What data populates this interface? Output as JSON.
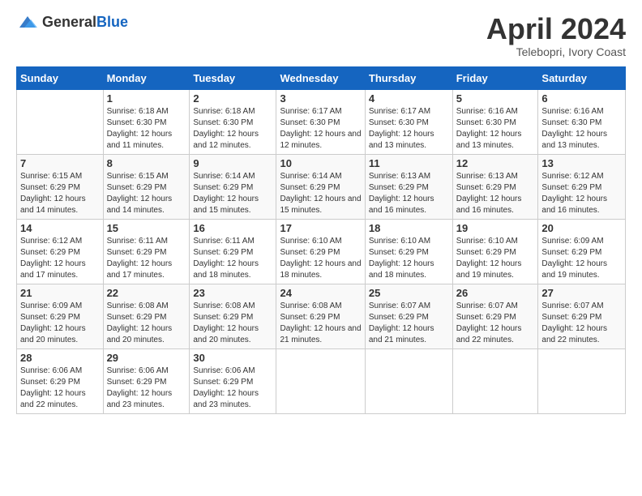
{
  "header": {
    "logo_general": "General",
    "logo_blue": "Blue",
    "title": "April 2024",
    "subtitle": "Telebopri, Ivory Coast"
  },
  "calendar": {
    "days_of_week": [
      "Sunday",
      "Monday",
      "Tuesday",
      "Wednesday",
      "Thursday",
      "Friday",
      "Saturday"
    ],
    "weeks": [
      [
        {
          "day": "",
          "sunrise": "",
          "sunset": "",
          "daylight": ""
        },
        {
          "day": "1",
          "sunrise": "Sunrise: 6:18 AM",
          "sunset": "Sunset: 6:30 PM",
          "daylight": "Daylight: 12 hours and 11 minutes."
        },
        {
          "day": "2",
          "sunrise": "Sunrise: 6:18 AM",
          "sunset": "Sunset: 6:30 PM",
          "daylight": "Daylight: 12 hours and 12 minutes."
        },
        {
          "day": "3",
          "sunrise": "Sunrise: 6:17 AM",
          "sunset": "Sunset: 6:30 PM",
          "daylight": "Daylight: 12 hours and 12 minutes."
        },
        {
          "day": "4",
          "sunrise": "Sunrise: 6:17 AM",
          "sunset": "Sunset: 6:30 PM",
          "daylight": "Daylight: 12 hours and 13 minutes."
        },
        {
          "day": "5",
          "sunrise": "Sunrise: 6:16 AM",
          "sunset": "Sunset: 6:30 PM",
          "daylight": "Daylight: 12 hours and 13 minutes."
        },
        {
          "day": "6",
          "sunrise": "Sunrise: 6:16 AM",
          "sunset": "Sunset: 6:30 PM",
          "daylight": "Daylight: 12 hours and 13 minutes."
        }
      ],
      [
        {
          "day": "7",
          "sunrise": "Sunrise: 6:15 AM",
          "sunset": "Sunset: 6:29 PM",
          "daylight": "Daylight: 12 hours and 14 minutes."
        },
        {
          "day": "8",
          "sunrise": "Sunrise: 6:15 AM",
          "sunset": "Sunset: 6:29 PM",
          "daylight": "Daylight: 12 hours and 14 minutes."
        },
        {
          "day": "9",
          "sunrise": "Sunrise: 6:14 AM",
          "sunset": "Sunset: 6:29 PM",
          "daylight": "Daylight: 12 hours and 15 minutes."
        },
        {
          "day": "10",
          "sunrise": "Sunrise: 6:14 AM",
          "sunset": "Sunset: 6:29 PM",
          "daylight": "Daylight: 12 hours and 15 minutes."
        },
        {
          "day": "11",
          "sunrise": "Sunrise: 6:13 AM",
          "sunset": "Sunset: 6:29 PM",
          "daylight": "Daylight: 12 hours and 16 minutes."
        },
        {
          "day": "12",
          "sunrise": "Sunrise: 6:13 AM",
          "sunset": "Sunset: 6:29 PM",
          "daylight": "Daylight: 12 hours and 16 minutes."
        },
        {
          "day": "13",
          "sunrise": "Sunrise: 6:12 AM",
          "sunset": "Sunset: 6:29 PM",
          "daylight": "Daylight: 12 hours and 16 minutes."
        }
      ],
      [
        {
          "day": "14",
          "sunrise": "Sunrise: 6:12 AM",
          "sunset": "Sunset: 6:29 PM",
          "daylight": "Daylight: 12 hours and 17 minutes."
        },
        {
          "day": "15",
          "sunrise": "Sunrise: 6:11 AM",
          "sunset": "Sunset: 6:29 PM",
          "daylight": "Daylight: 12 hours and 17 minutes."
        },
        {
          "day": "16",
          "sunrise": "Sunrise: 6:11 AM",
          "sunset": "Sunset: 6:29 PM",
          "daylight": "Daylight: 12 hours and 18 minutes."
        },
        {
          "day": "17",
          "sunrise": "Sunrise: 6:10 AM",
          "sunset": "Sunset: 6:29 PM",
          "daylight": "Daylight: 12 hours and 18 minutes."
        },
        {
          "day": "18",
          "sunrise": "Sunrise: 6:10 AM",
          "sunset": "Sunset: 6:29 PM",
          "daylight": "Daylight: 12 hours and 18 minutes."
        },
        {
          "day": "19",
          "sunrise": "Sunrise: 6:10 AM",
          "sunset": "Sunset: 6:29 PM",
          "daylight": "Daylight: 12 hours and 19 minutes."
        },
        {
          "day": "20",
          "sunrise": "Sunrise: 6:09 AM",
          "sunset": "Sunset: 6:29 PM",
          "daylight": "Daylight: 12 hours and 19 minutes."
        }
      ],
      [
        {
          "day": "21",
          "sunrise": "Sunrise: 6:09 AM",
          "sunset": "Sunset: 6:29 PM",
          "daylight": "Daylight: 12 hours and 20 minutes."
        },
        {
          "day": "22",
          "sunrise": "Sunrise: 6:08 AM",
          "sunset": "Sunset: 6:29 PM",
          "daylight": "Daylight: 12 hours and 20 minutes."
        },
        {
          "day": "23",
          "sunrise": "Sunrise: 6:08 AM",
          "sunset": "Sunset: 6:29 PM",
          "daylight": "Daylight: 12 hours and 20 minutes."
        },
        {
          "day": "24",
          "sunrise": "Sunrise: 6:08 AM",
          "sunset": "Sunset: 6:29 PM",
          "daylight": "Daylight: 12 hours and 21 minutes."
        },
        {
          "day": "25",
          "sunrise": "Sunrise: 6:07 AM",
          "sunset": "Sunset: 6:29 PM",
          "daylight": "Daylight: 12 hours and 21 minutes."
        },
        {
          "day": "26",
          "sunrise": "Sunrise: 6:07 AM",
          "sunset": "Sunset: 6:29 PM",
          "daylight": "Daylight: 12 hours and 22 minutes."
        },
        {
          "day": "27",
          "sunrise": "Sunrise: 6:07 AM",
          "sunset": "Sunset: 6:29 PM",
          "daylight": "Daylight: 12 hours and 22 minutes."
        }
      ],
      [
        {
          "day": "28",
          "sunrise": "Sunrise: 6:06 AM",
          "sunset": "Sunset: 6:29 PM",
          "daylight": "Daylight: 12 hours and 22 minutes."
        },
        {
          "day": "29",
          "sunrise": "Sunrise: 6:06 AM",
          "sunset": "Sunset: 6:29 PM",
          "daylight": "Daylight: 12 hours and 23 minutes."
        },
        {
          "day": "30",
          "sunrise": "Sunrise: 6:06 AM",
          "sunset": "Sunset: 6:29 PM",
          "daylight": "Daylight: 12 hours and 23 minutes."
        },
        {
          "day": "",
          "sunrise": "",
          "sunset": "",
          "daylight": ""
        },
        {
          "day": "",
          "sunrise": "",
          "sunset": "",
          "daylight": ""
        },
        {
          "day": "",
          "sunrise": "",
          "sunset": "",
          "daylight": ""
        },
        {
          "day": "",
          "sunrise": "",
          "sunset": "",
          "daylight": ""
        }
      ]
    ]
  }
}
